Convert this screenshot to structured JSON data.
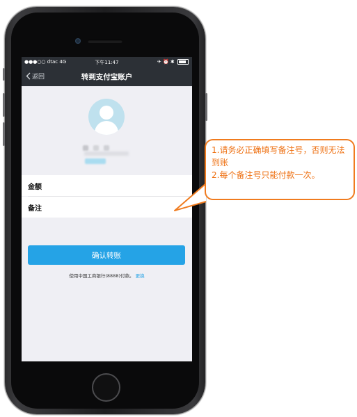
{
  "status_bar": {
    "carrier": "●●●○○ dtac  4G",
    "time": "下午11:47",
    "right_icons": "✈ ⏰ ✱"
  },
  "nav": {
    "back_label": "返回",
    "title": "转到支付宝账户"
  },
  "form": {
    "amount_label": "金额",
    "note_label": "备注"
  },
  "confirm_button": "确认转账",
  "payment_note": {
    "text": "使用中国工商银行(8888)付款。",
    "change_link": "更换"
  },
  "callout": {
    "line1": "1.请务必正确填写备注号，否则无法到账",
    "line2": "2.每个备注号只能付款一次。"
  },
  "colors": {
    "accent": "#25a3e6",
    "nav_bg": "#2c3036",
    "callout": "#f07b1e",
    "avatar": "#bfe1ee"
  },
  "icons": {
    "back": "chevron-left-icon",
    "avatar": "user-avatar-icon",
    "battery": "battery-icon"
  }
}
